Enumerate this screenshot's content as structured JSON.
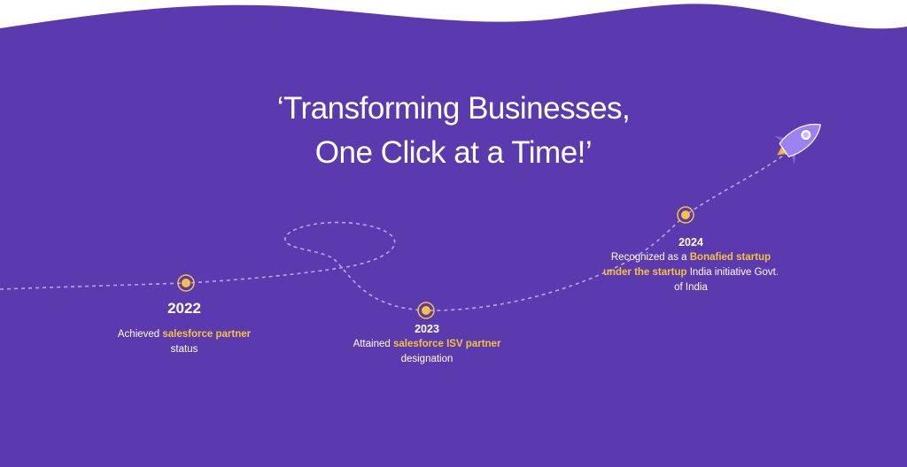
{
  "headline": {
    "line1": "‘Transforming Businesses,",
    "line2": "One Click at a Time!’"
  },
  "milestones": [
    {
      "year": "2022",
      "pre": "Achieved ",
      "highlight": "salesforce partner",
      "post": "status"
    },
    {
      "year": "2023",
      "pre": "Attained ",
      "highlight": "salesforce ISV partner",
      "post": " designation"
    },
    {
      "year": "2024",
      "pre": "Recognized as a ",
      "highlight": "Bonafied startup under the startup",
      "post": " India initiative Govt. of India"
    }
  ],
  "colors": {
    "background": "#5b3ab0",
    "top_wave": "#ffffff",
    "accent": "#f6c23b",
    "path": "#b7a8ee",
    "rocket": "#9b82f0"
  },
  "icons": [
    "rocket-icon",
    "milestone-dot-icon"
  ]
}
